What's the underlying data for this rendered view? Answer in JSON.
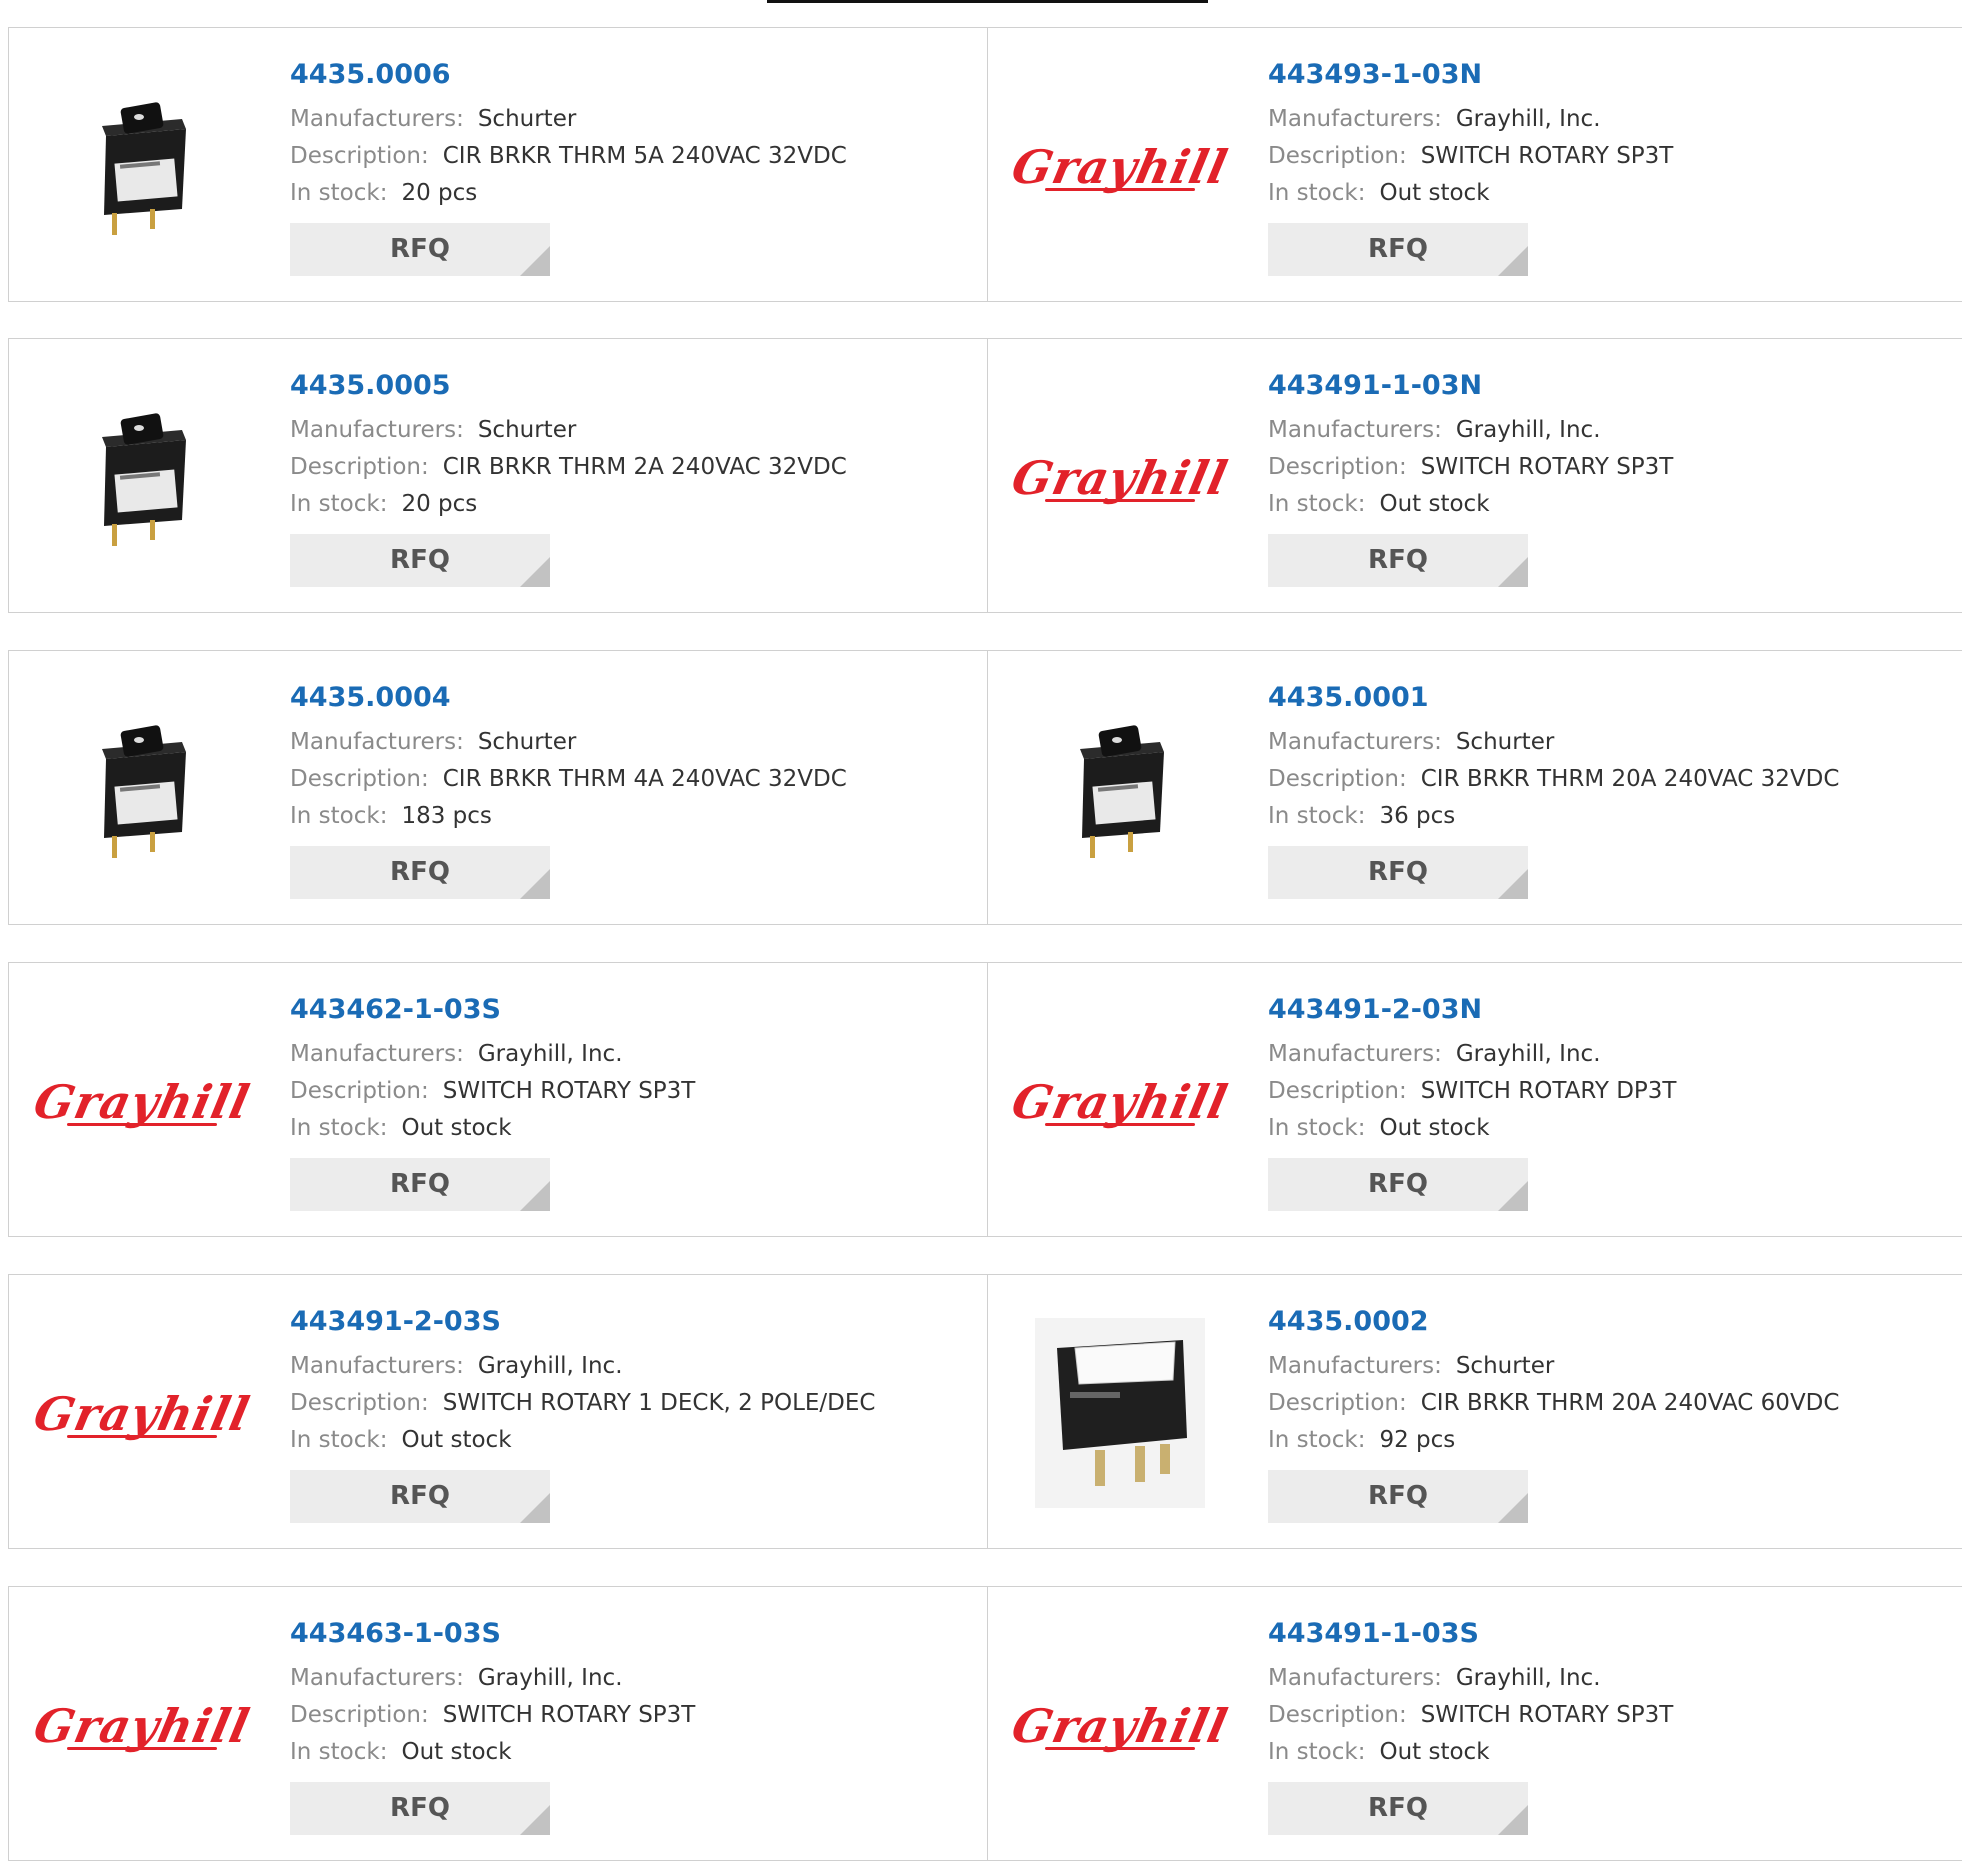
{
  "labels": {
    "manufacturers": "Manufacturers:",
    "description": "Description:",
    "in_stock": "In stock:",
    "rfq": "RFQ"
  },
  "brand_colors": {
    "link": "#1a6bb5",
    "grayhill_red": "#e2222a"
  },
  "products": [
    {
      "pn": "4435.0006",
      "manufacturer": "Schurter",
      "description": "CIR BRKR THRM 5A 240VAC 32VDC",
      "stock": "20 pcs",
      "image": "breaker-small-icon"
    },
    {
      "pn": "443493-1-03N",
      "manufacturer": "Grayhill, Inc.",
      "description": "SWITCH ROTARY SP3T",
      "stock": "Out stock",
      "image": "grayhill-logo",
      "logo_text": "Grayhill"
    },
    {
      "pn": "4435.0005",
      "manufacturer": "Schurter",
      "description": "CIR BRKR THRM 2A 240VAC 32VDC",
      "stock": "20 pcs",
      "image": "breaker-small-icon"
    },
    {
      "pn": "443491-1-03N",
      "manufacturer": "Grayhill, Inc.",
      "description": "SWITCH ROTARY SP3T",
      "stock": "Out stock",
      "image": "grayhill-logo",
      "logo_text": "Grayhill"
    },
    {
      "pn": "4435.0004",
      "manufacturer": "Schurter",
      "description": "CIR BRKR THRM 4A 240VAC 32VDC",
      "stock": "183 pcs",
      "image": "breaker-small-icon"
    },
    {
      "pn": "4435.0001",
      "manufacturer": "Schurter",
      "description": "CIR BRKR THRM 20A 240VAC 32VDC",
      "stock": "36 pcs",
      "image": "breaker-small-icon"
    },
    {
      "pn": "443462-1-03S",
      "manufacturer": "Grayhill, Inc.",
      "description": "SWITCH ROTARY SP3T",
      "stock": "Out stock",
      "image": "grayhill-logo",
      "logo_text": "Grayhill"
    },
    {
      "pn": "443491-2-03N",
      "manufacturer": "Grayhill, Inc.",
      "description": "SWITCH ROTARY DP3T",
      "stock": "Out stock",
      "image": "grayhill-logo",
      "logo_text": "Grayhill"
    },
    {
      "pn": "443491-2-03S",
      "manufacturer": "Grayhill, Inc.",
      "description": "SWITCH ROTARY 1 DECK, 2 POLE/DEC",
      "stock": "Out stock",
      "image": "grayhill-logo",
      "logo_text": "Grayhill"
    },
    {
      "pn": "4435.0002",
      "manufacturer": "Schurter",
      "description": "CIR BRKR THRM 20A 240VAC 60VDC",
      "stock": "92 pcs",
      "image": "breaker-large-icon"
    },
    {
      "pn": "443463-1-03S",
      "manufacturer": "Grayhill, Inc.",
      "description": "SWITCH ROTARY SP3T",
      "stock": "Out stock",
      "image": "grayhill-logo",
      "logo_text": "Grayhill"
    },
    {
      "pn": "443491-1-03S",
      "manufacturer": "Grayhill, Inc.",
      "description": "SWITCH ROTARY SP3T",
      "stock": "Out stock",
      "image": "grayhill-logo",
      "logo_text": "Grayhill"
    }
  ]
}
